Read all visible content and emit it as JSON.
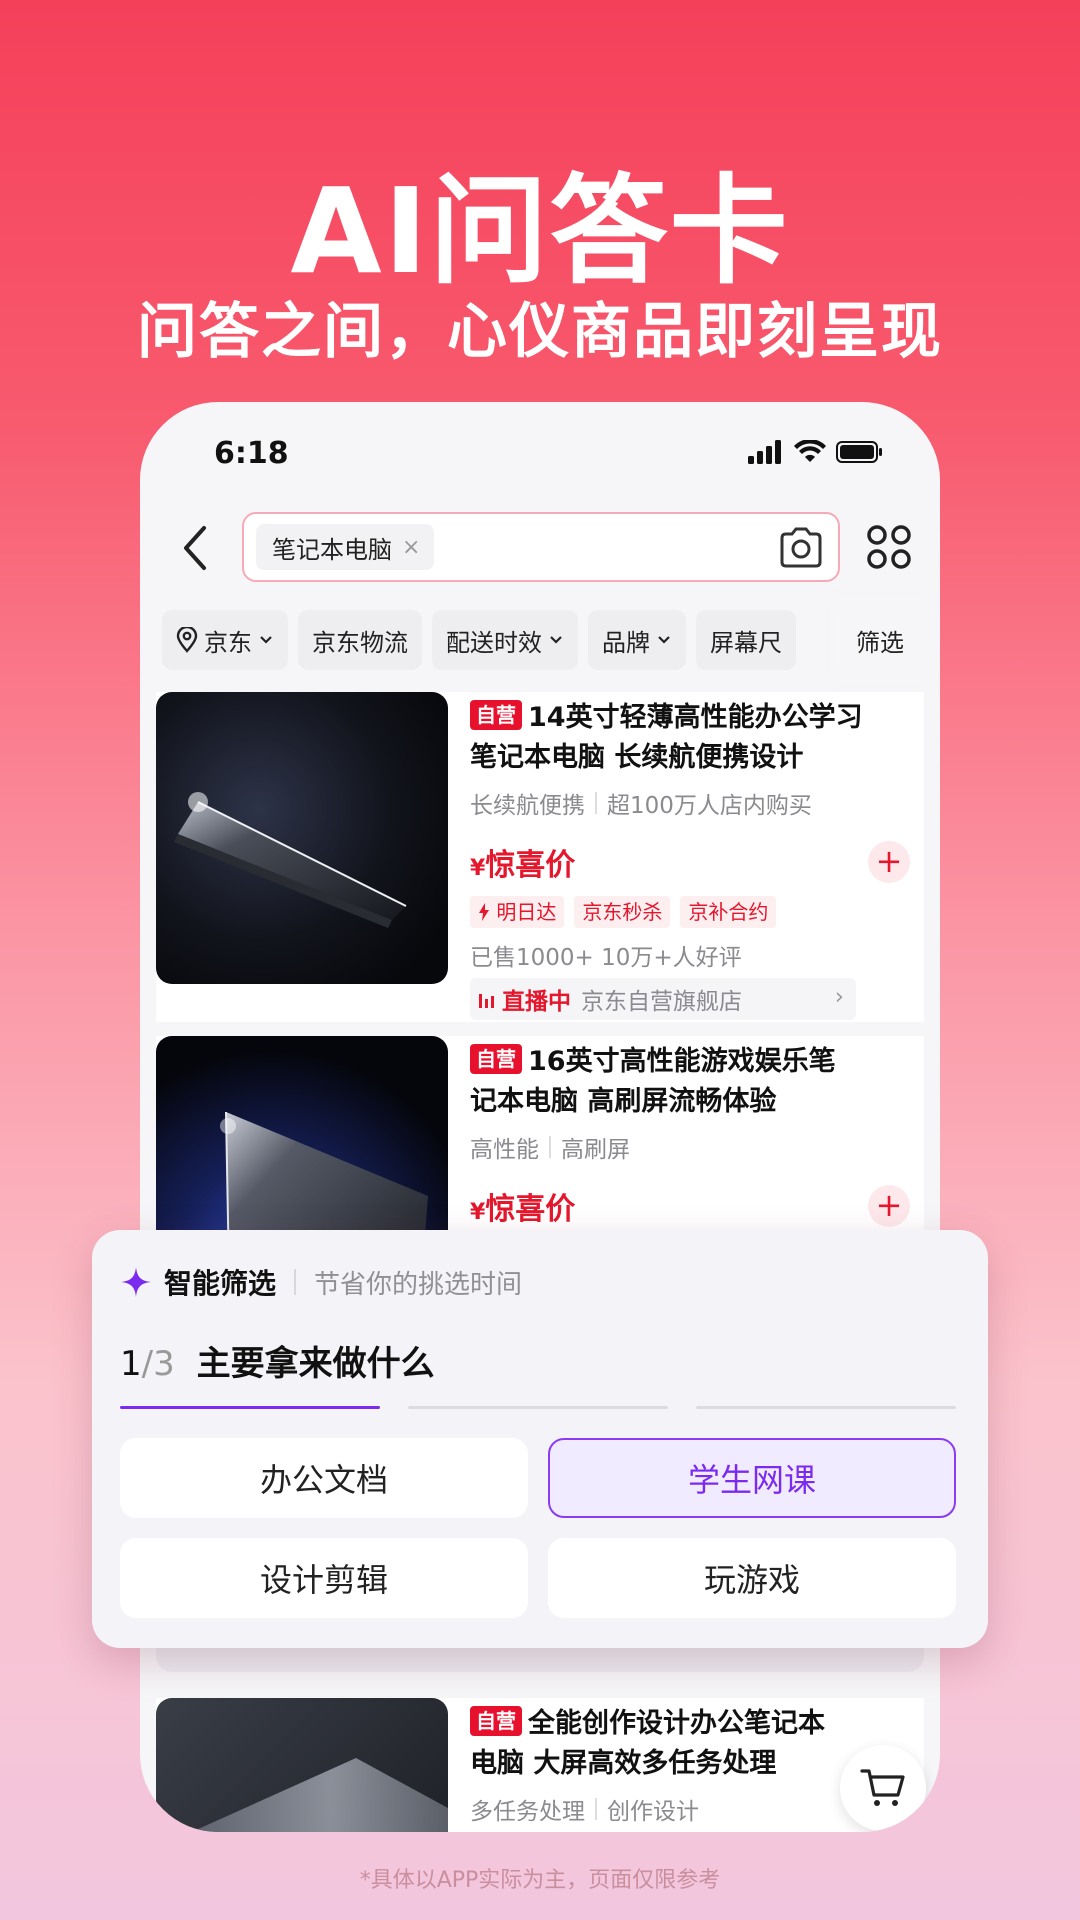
{
  "hero": {
    "title": "AI问答卡",
    "subtitle": "问答之间，心仪商品即刻呈现"
  },
  "status_bar": {
    "time": "6:18",
    "icons": [
      "signal-icon",
      "wifi-icon",
      "battery-icon"
    ]
  },
  "search": {
    "chip_label": "笔记本电脑",
    "chip_close": "×"
  },
  "filters": {
    "location": "京东",
    "logistics": "京东物流",
    "delivery": "配送时效",
    "brand": "品牌",
    "screen": "屏幕尺",
    "more": "筛选"
  },
  "products": [
    {
      "self_tag": "自营",
      "title": "14英寸轻薄高性能办公学习笔记本电脑 长续航便携设计",
      "title_line1": "14英寸轻薄高性能办公学习",
      "title_line2": "笔记本电脑 长续航便携设计",
      "features": [
        "长续航便携",
        "超100万人店内购买"
      ],
      "price_symbol": "¥",
      "price_label": "惊喜价",
      "add": "+",
      "promos": [
        "明日达",
        "京东秒杀",
        "京补合约"
      ],
      "sold": "已售1000+  10万+人好评",
      "live_label": "直播中",
      "live_store": "京东自营旗舰店",
      "live_chevron": "›"
    },
    {
      "self_tag": "自营",
      "title_line1": "16英寸高性能游戏娱乐笔",
      "title_line2": "记本电脑 高刷屏流畅体验",
      "features": [
        "高性能",
        "高刷屏"
      ],
      "price_symbol": "¥",
      "price_label": "惊喜价",
      "add": "+"
    },
    {
      "self_tag": "自营",
      "title_line1": "全能创作设计办公笔记本",
      "title_line2": "电脑 大屏高效多任务处理",
      "features": [
        "多任务处理",
        "创作设计"
      ]
    }
  ],
  "ai_card": {
    "title": "智能筛选",
    "subtitle": "节省你的挑选时间",
    "step": "1",
    "total": "/3",
    "question": "主要拿来做什么",
    "progress_current": 1,
    "progress_total": 3,
    "options": [
      {
        "label": "办公文档",
        "selected": false
      },
      {
        "label": "学生网课",
        "selected": true
      },
      {
        "label": "设计剪辑",
        "selected": false
      },
      {
        "label": "玩游戏",
        "selected": false
      }
    ]
  },
  "footnote": "*具体以APP实际为主，页面仅限参考",
  "colors": {
    "brand_red": "#e5172c",
    "accent_purple": "#7b2bf0"
  }
}
